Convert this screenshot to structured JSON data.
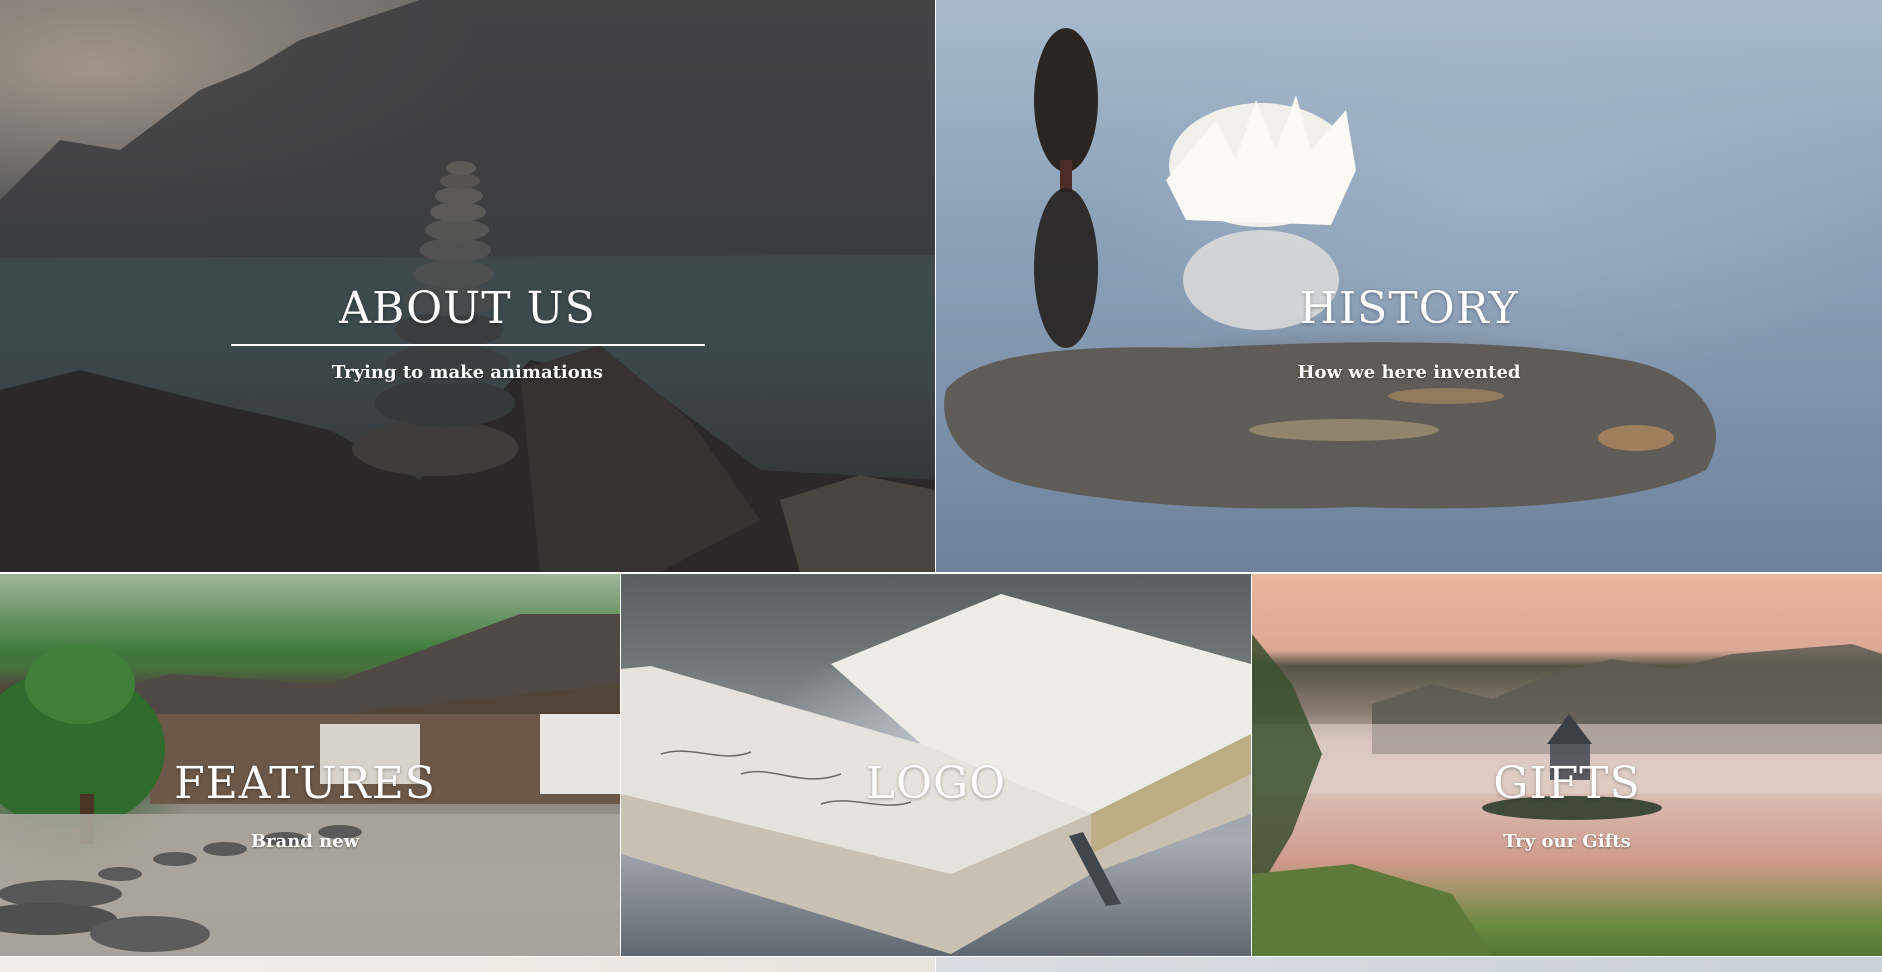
{
  "tiles": {
    "about": {
      "title": "ABOUT US",
      "subtitle": "Trying to make animations"
    },
    "history": {
      "title": "HISTORY",
      "subtitle": "How we here invented"
    },
    "features": {
      "title": "FEATURES",
      "subtitle": "Brand new"
    },
    "logo": {
      "title": "LOGO",
      "subtitle": ""
    },
    "gifts": {
      "title": "GIFTS",
      "subtitle": "Try our Gifts"
    }
  },
  "colors": {
    "text": "#ffffff",
    "divider": "#ffffff"
  }
}
